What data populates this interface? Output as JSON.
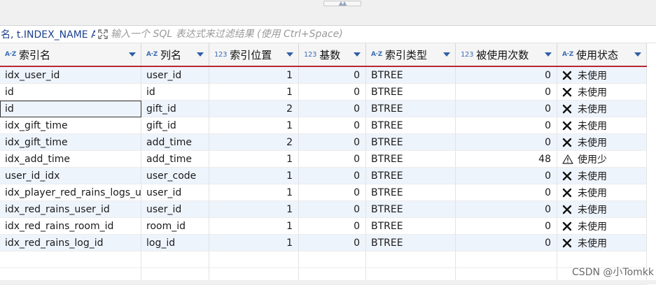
{
  "filter": {
    "prefix": "名, t.INDEX_NAME A",
    "placeholder": "输入一个 SQL 表达式来过滤结果 (使用 Ctrl+Space)",
    "value": ""
  },
  "columns": [
    {
      "label": "索引名",
      "type_badge": "A·Z",
      "kind": "text"
    },
    {
      "label": "列名",
      "type_badge": "A·Z",
      "kind": "text"
    },
    {
      "label": "索引位置",
      "type_badge": "123",
      "kind": "num"
    },
    {
      "label": "基数",
      "type_badge": "123",
      "kind": "num"
    },
    {
      "label": "索引类型",
      "type_badge": "A·Z",
      "kind": "text"
    },
    {
      "label": "被使用次数",
      "type_badge": "123",
      "kind": "num"
    },
    {
      "label": "使用状态",
      "type_badge": "A·Z",
      "kind": "text"
    }
  ],
  "rows": [
    {
      "name": "idx_user_id",
      "column": "user_id",
      "position": "1",
      "cardinality": "0",
      "type": "BTREE",
      "used": "0",
      "status": "未使用",
      "status_icon": "x-icon"
    },
    {
      "name": "id",
      "column": "id",
      "position": "1",
      "cardinality": "0",
      "type": "BTREE",
      "used": "0",
      "status": "未使用",
      "status_icon": "x-icon"
    },
    {
      "name": "id",
      "column": "gift_id",
      "position": "2",
      "cardinality": "0",
      "type": "BTREE",
      "used": "0",
      "status": "未使用",
      "status_icon": "x-icon"
    },
    {
      "name": "idx_gift_time",
      "column": "gift_id",
      "position": "1",
      "cardinality": "0",
      "type": "BTREE",
      "used": "0",
      "status": "未使用",
      "status_icon": "x-icon"
    },
    {
      "name": "idx_gift_time",
      "column": "add_time",
      "position": "2",
      "cardinality": "0",
      "type": "BTREE",
      "used": "0",
      "status": "未使用",
      "status_icon": "x-icon"
    },
    {
      "name": "idx_add_time",
      "column": "add_time",
      "position": "1",
      "cardinality": "0",
      "type": "BTREE",
      "used": "48",
      "status": "使用少",
      "status_icon": "warning-icon"
    },
    {
      "name": "user_id_idx",
      "column": "user_code",
      "position": "1",
      "cardinality": "0",
      "type": "BTREE",
      "used": "0",
      "status": "未使用",
      "status_icon": "x-icon"
    },
    {
      "name": "idx_player_red_rains_logs_use",
      "column": "user_id",
      "position": "1",
      "cardinality": "0",
      "type": "BTREE",
      "used": "0",
      "status": "未使用",
      "status_icon": "x-icon"
    },
    {
      "name": "idx_red_rains_user_id",
      "column": "user_id",
      "position": "1",
      "cardinality": "0",
      "type": "BTREE",
      "used": "0",
      "status": "未使用",
      "status_icon": "x-icon"
    },
    {
      "name": "idx_red_rains_room_id",
      "column": "room_id",
      "position": "1",
      "cardinality": "0",
      "type": "BTREE",
      "used": "0",
      "status": "未使用",
      "status_icon": "x-icon"
    },
    {
      "name": "idx_red_rains_log_id",
      "column": "log_id",
      "position": "1",
      "cardinality": "0",
      "type": "BTREE",
      "used": "0",
      "status": "未使用",
      "status_icon": "x-icon"
    }
  ],
  "watermark": "CSDN @小Tomkk",
  "colors": {
    "accent_line": "#b8282e",
    "row_alt": "#eef4fc",
    "badge": "#3d6db5",
    "prefix_text": "#1b3f8c"
  }
}
